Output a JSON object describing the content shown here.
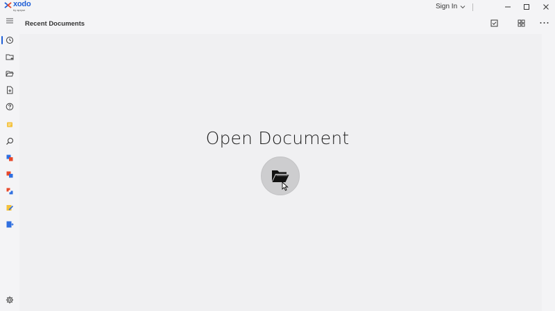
{
  "app": {
    "logo_text": "xodo",
    "logo_sub": "by apryse",
    "brand_color": "#1f5fd6"
  },
  "titlebar": {
    "signin_label": "Sign In",
    "controls": [
      "minimize-icon",
      "maximize-icon",
      "close-icon"
    ]
  },
  "sidebar": {
    "items": [
      {
        "name": "menu-icon"
      },
      {
        "name": "recent-icon",
        "active": true
      },
      {
        "name": "folder-add-icon"
      },
      {
        "name": "folder-open-icon"
      },
      {
        "name": "new-document-icon"
      },
      {
        "name": "help-icon"
      },
      {
        "name": "notes-icon"
      },
      {
        "name": "search-icon"
      },
      {
        "name": "convert-icon"
      },
      {
        "name": "word-convert-icon"
      },
      {
        "name": "merge-icon"
      },
      {
        "name": "edit-icon"
      },
      {
        "name": "export-icon"
      },
      {
        "name": "settings-icon"
      }
    ]
  },
  "header": {
    "title": "Recent Documents",
    "actions": [
      "select-icon",
      "grid-view-icon",
      "more-icon"
    ]
  },
  "main": {
    "open_title": "Open Document",
    "open_button_icon": "folder-open-icon"
  }
}
